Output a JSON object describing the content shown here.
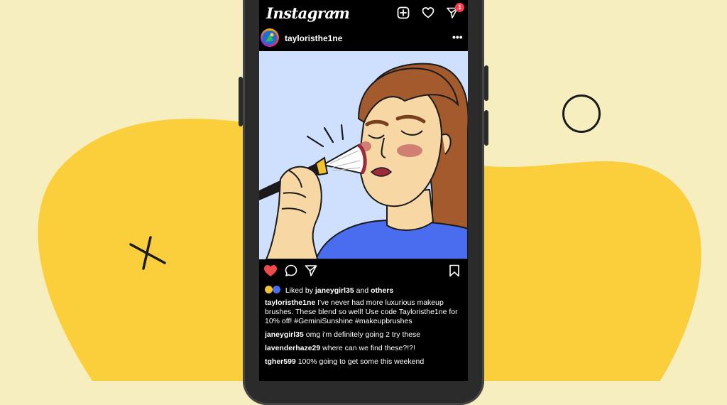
{
  "app": {
    "name": "Instagram",
    "notification_count": "1"
  },
  "post": {
    "username": "tayloristhe1ne",
    "more_label": "•••",
    "liked_by_prefix": "Liked by",
    "liked_by_user": "janeygirl35",
    "liked_by_conj": "and",
    "liked_by_others": "others",
    "liked": true,
    "caption_user": "tayloristhe1ne",
    "caption_text": "I've never had more luxurious makeup brushes. These blend so well! Use code Tayloristhe1ne for 10% off! #GeminiSunshine #makeupbrushes"
  },
  "comments": [
    {
      "user": "janeygirl35",
      "text": "omg i'm definitely going 2 try these"
    },
    {
      "user": "lavenderhaze29",
      "text": "where can we find these?!?!"
    },
    {
      "user": "tgher599",
      "text": "100% going to get some this weekend"
    }
  ],
  "icons": {
    "logo_chevron": "chevron-down-icon",
    "new_post": "plus-square-icon",
    "activity": "heart-icon",
    "direct": "send-icon",
    "like": "heart-filled-icon",
    "comment": "comment-icon",
    "share": "send-icon",
    "save": "bookmark-icon"
  },
  "colors": {
    "background": "#f7eec0",
    "blob": "#fbcf3c",
    "like_red": "#f04a4a",
    "badge_red": "#ff3b4a",
    "shirt_blue": "#4a6df0",
    "hair_brown": "#a35a2c",
    "skin": "#f7d8a5",
    "sky": "#cfe0ff"
  }
}
